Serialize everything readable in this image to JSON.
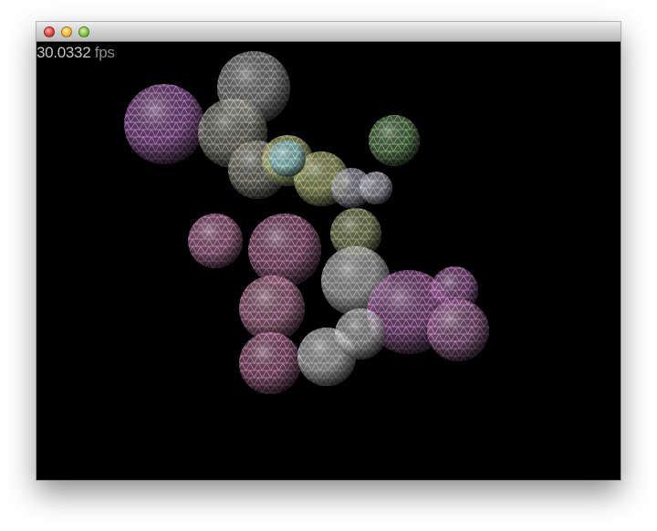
{
  "window": {
    "controls": {
      "close": "close-button",
      "minimize": "minimize-button",
      "zoom": "zoom-button"
    }
  },
  "hud": {
    "fps_value": "30.0332",
    "fps_unit": "fps"
  },
  "scene": {
    "background": "#000000",
    "wire_color": "#ffffff"
  }
}
